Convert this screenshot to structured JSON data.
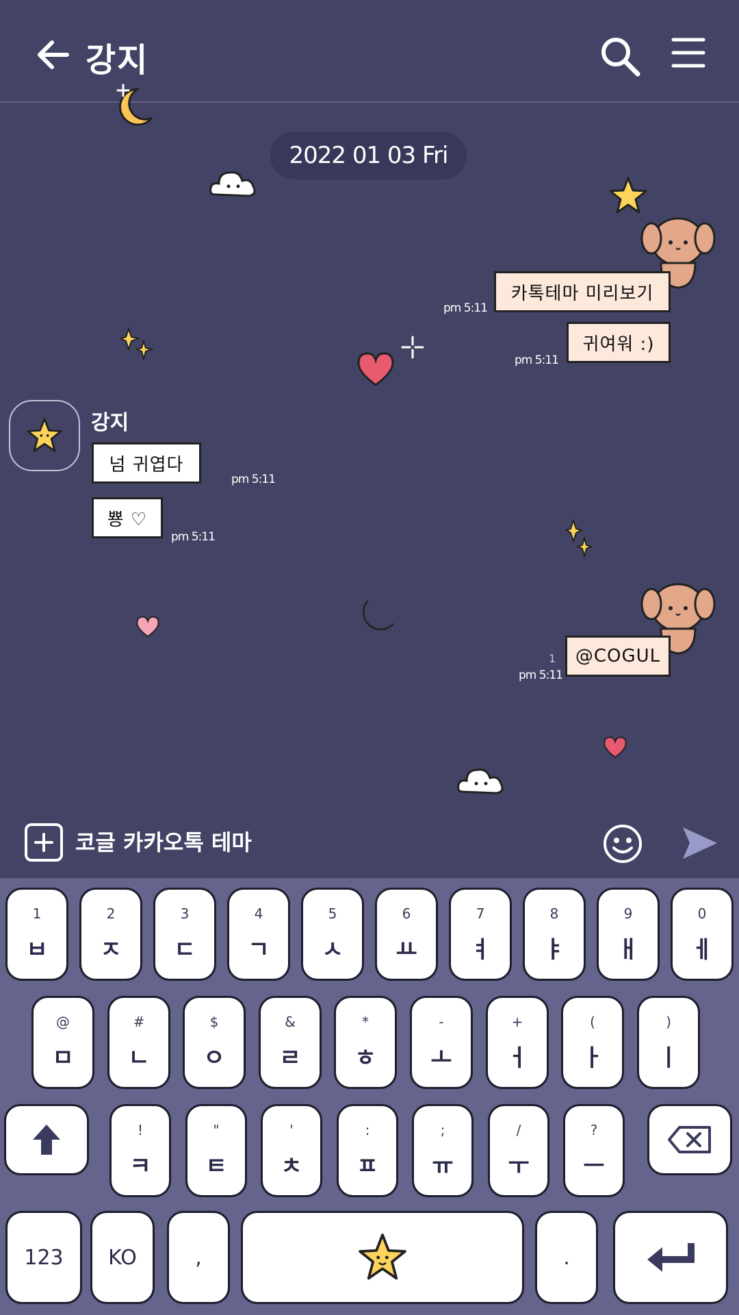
{
  "header": {
    "title": "강지"
  },
  "date_label": "2022 01 03 Fri",
  "messages": {
    "sent_1": {
      "text": "카톡테마 미리보기",
      "time": "pm 5:11"
    },
    "sent_2": {
      "text": "귀여워 :)",
      "time": "pm 5:11"
    },
    "received_sender": "강지",
    "received_1": {
      "text": "넘 귀엽다",
      "time": "pm 5:11"
    },
    "received_2": {
      "text": "뿅 ♡",
      "time": "pm 5:11"
    },
    "sent_3": {
      "text": "@COGUL",
      "time": "pm 5:11",
      "unread": "1"
    }
  },
  "input": {
    "placeholder": "코글 카카오톡 테마"
  },
  "keyboard": {
    "row1": [
      {
        "sub": "1",
        "main": "ㅂ"
      },
      {
        "sub": "2",
        "main": "ㅈ"
      },
      {
        "sub": "3",
        "main": "ㄷ"
      },
      {
        "sub": "4",
        "main": "ㄱ"
      },
      {
        "sub": "5",
        "main": "ㅅ"
      },
      {
        "sub": "6",
        "main": "ㅛ"
      },
      {
        "sub": "7",
        "main": "ㅕ"
      },
      {
        "sub": "8",
        "main": "ㅑ"
      },
      {
        "sub": "9",
        "main": "ㅐ"
      },
      {
        "sub": "0",
        "main": "ㅔ"
      }
    ],
    "row2": [
      {
        "sub": "@",
        "main": "ㅁ"
      },
      {
        "sub": "#",
        "main": "ㄴ"
      },
      {
        "sub": "$",
        "main": "ㅇ"
      },
      {
        "sub": "&",
        "main": "ㄹ"
      },
      {
        "sub": "*",
        "main": "ㅎ"
      },
      {
        "sub": "-",
        "main": "ㅗ"
      },
      {
        "sub": "+",
        "main": "ㅓ"
      },
      {
        "sub": "(",
        "main": "ㅏ"
      },
      {
        "sub": ")",
        "main": "ㅣ"
      }
    ],
    "row3": [
      {
        "sub": "!",
        "main": "ㅋ"
      },
      {
        "sub": "\"",
        "main": "ㅌ"
      },
      {
        "sub": "'",
        "main": "ㅊ"
      },
      {
        "sub": ":",
        "main": "ㅍ"
      },
      {
        "sub": ";",
        "main": "ㅠ"
      },
      {
        "sub": "/",
        "main": "ㅜ"
      },
      {
        "sub": "?",
        "main": "ㅡ"
      }
    ],
    "numbers_label": "123",
    "lang_label": "KO",
    "comma_label": ",",
    "period_label": "."
  },
  "colors": {
    "background": "#434366",
    "keyboard_background": "#64648c",
    "sent_bubble": "#fde8dc",
    "received_bubble": "#ffffff",
    "star": "#fcd45b",
    "heart": "#e85a6e",
    "moon": "#fcc654",
    "puppy": "#e3a88a"
  }
}
